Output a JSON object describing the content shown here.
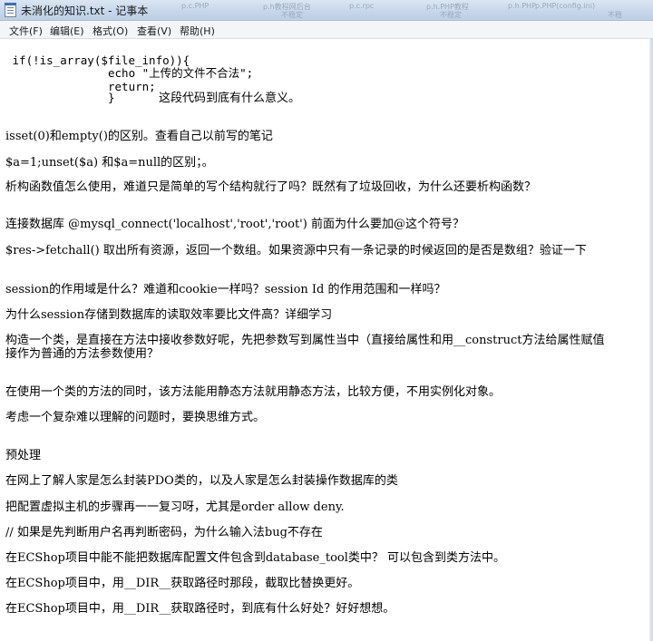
{
  "window": {
    "title": "未消化的知识.txt - 记事本",
    "background_tabs": [
      "p.c.PHP",
      "p.h教程网后台",
      "不稳定",
      "p.c.rpc",
      "p.h.PHP教程",
      "不稳定",
      "p.h.PHP",
      "p.PHP(config.ini)",
      "不稳"
    ]
  },
  "menu": {
    "items": [
      "文件(F)",
      "编辑(E)",
      "格式(O)",
      "查看(V)",
      "帮助(H)"
    ]
  },
  "editor": {
    "lines": [
      " if(!is_array($file_info)){",
      "echo \"上传的文件不合法\";",
      "return;",
      "}",
      "这段代码到底有什么意义。",
      "isset(0)和empty()的区别。查看自己以前写的笔记",
      "$a=1;unset($a) 和$a=null的区别；。",
      "析构函数值怎么使用，难道只是简单的写个结构就行了吗？既然有了垃圾回收，为什么还要析构函数？",
      "连接数据库 @mysql_connect('localhost','root','root') 前面为什么要加@这个符号？",
      "$res->fetchall() 取出所有资源，返回一个数组。如果资源中只有一条记录的时候返回的是否是数组？验证一下",
      "session的作用域是什么？难道和cookie一样吗？session Id 的作用范围和一样吗？",
      "为什么session存储到数据库的读取效率要比文件高？详细学习",
      "构造一个类，是直接在方法中接收参数好呢，先把参数写到属性当中（直接给属性和用__construct方法给属性赋值",
      "接作为普通的方法参数使用？",
      "在使用一个类的方法的同时，该方法能用静态方法就用静态方法，比较方便，不用实例化对象。",
      "考虑一个复杂难以理解的问题时，要换思维方式。",
      "预处理",
      "在网上了解人家是怎么封装PDO类的，以及人家是怎么封装操作数据库的类",
      "把配置虚拟主机的步骤再一一复习呀，尤其是order allow deny.",
      "// 如果是先判断用户名再判断密码，为什么输入法bug不存在",
      "在ECShop项目中能不能把数据库配置文件包含到database_tool类中？ 可以包含到类方法中。",
      "在ECShop项目中，用__DIR__获取路径时那段，截取比替换更好。",
      "在ECShop项目中，用__DIR__获取路径时，到底有什么好处？好好想想。"
    ]
  }
}
